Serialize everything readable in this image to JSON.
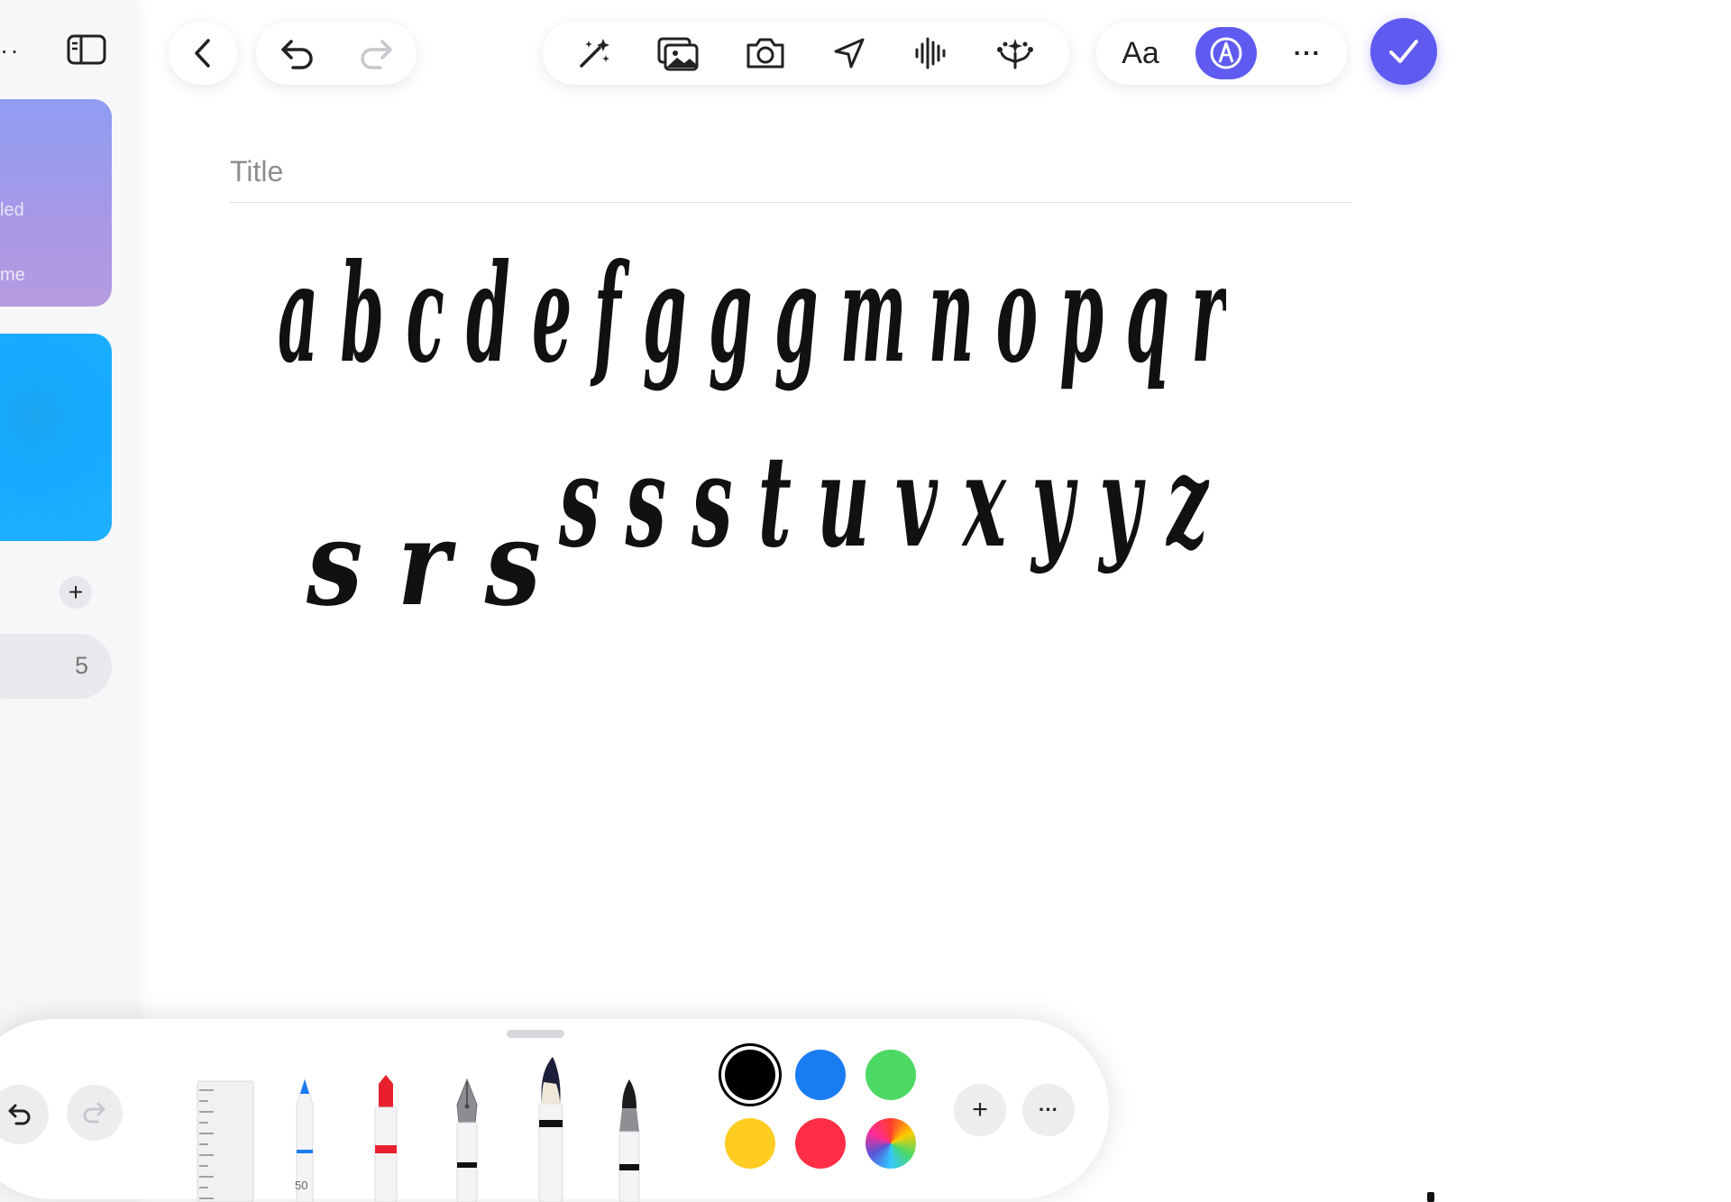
{
  "sidebar": {
    "menu_dots": "··",
    "card1_lines": [
      "led",
      "me"
    ],
    "row_count": "5",
    "add_label": "+"
  },
  "top_toolbar": {
    "icons": [
      "chevron-left-icon",
      "undo-icon",
      "redo-icon",
      "magic-wand-icon",
      "photo-library-icon",
      "camera-icon",
      "location-icon",
      "waveform-icon",
      "sparkle-tree-icon",
      "text-format-icon",
      "markup-icon",
      "more-icon",
      "done-checkmark-icon"
    ],
    "text_format_label": "Aa",
    "more_label": "···"
  },
  "note": {
    "title_placeholder": "Title",
    "handwriting_rows": [
      "a b c d e f g g g m n o p q r",
      "s s s t u v x y y z",
      "s r s"
    ]
  },
  "drawing_toolbar": {
    "tools": [
      "ruler",
      "pencil",
      "crayon",
      "fountain-pen",
      "brush",
      "marker"
    ],
    "pencil_width_label": "50",
    "colors": [
      {
        "name": "black",
        "hex": "#000000",
        "selected": true
      },
      {
        "name": "blue",
        "hex": "#1a7cf2"
      },
      {
        "name": "green",
        "hex": "#4cd964"
      },
      {
        "name": "yellow",
        "hex": "#ffcc22"
      },
      {
        "name": "red",
        "hex": "#ff2d45"
      },
      {
        "name": "multicolor",
        "hex": "conic"
      }
    ],
    "add_label": "+",
    "more_label": "···"
  },
  "accent_color": "#5f5bf0"
}
